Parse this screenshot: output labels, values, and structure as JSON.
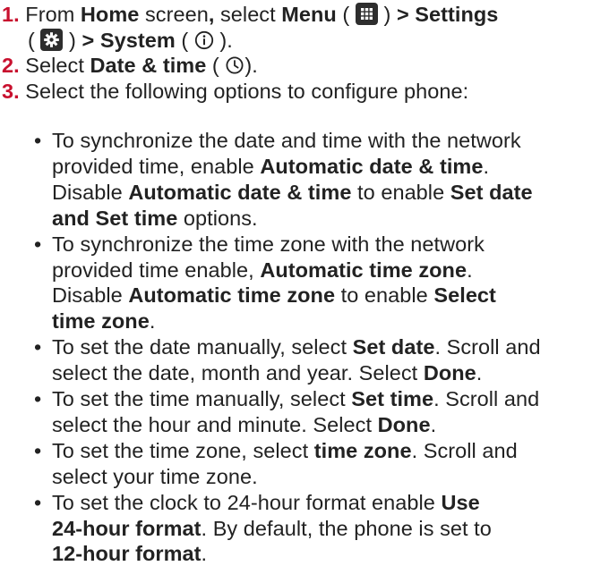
{
  "steps": [
    {
      "number": "1.",
      "line1": {
        "t1": "From ",
        "b1": "Home",
        "t2": " screen",
        "b2": ",",
        "t3": " select ",
        "b3": "Menu",
        "t4": " ( ",
        "t5": " ) ",
        "b4": "> Settings"
      },
      "line2": {
        "t1": "( ",
        "t2": " ) ",
        "b1": "> System",
        "t3": " ( ",
        "t4": " )."
      }
    },
    {
      "number": "2.",
      "t1": "Select ",
      "b1": "Date & time",
      "t2": " ( ",
      "t3": ")."
    },
    {
      "number": "3.",
      "t1": "Select the following options to configure phone:"
    }
  ],
  "bullets": [
    {
      "lines": [
        [
          {
            "t": "To synchronize the date and time with the network"
          }
        ],
        [
          {
            "t": "provided time, enable "
          },
          {
            "b": "Automatic date & time"
          },
          {
            "t": "."
          }
        ],
        [
          {
            "t": "Disable "
          },
          {
            "b": "Automatic date & time"
          },
          {
            "t": " to enable "
          },
          {
            "b": "Set date"
          }
        ],
        [
          {
            "b": "and "
          },
          {
            "b": "Set time"
          },
          {
            "t": " options."
          }
        ]
      ]
    },
    {
      "lines": [
        [
          {
            "t": "To synchronize the time zone with the network"
          }
        ],
        [
          {
            "t": "provided time enable, "
          },
          {
            "b": "Automatic time zone"
          },
          {
            "t": "."
          }
        ],
        [
          {
            "t": "Disable "
          },
          {
            "b": "Automatic time zone"
          },
          {
            "t": " to enable "
          },
          {
            "b": "Select"
          }
        ],
        [
          {
            "b": "time zone"
          },
          {
            "t": "."
          }
        ]
      ]
    },
    {
      "lines": [
        [
          {
            "t": "To set the date manually, select "
          },
          {
            "b": "Set date"
          },
          {
            "t": ". Scroll and"
          }
        ],
        [
          {
            "t": "select the date, month and year. Select "
          },
          {
            "b": "Done"
          },
          {
            "t": "."
          }
        ]
      ]
    },
    {
      "lines": [
        [
          {
            "t": "To set the time manually, select "
          },
          {
            "b": "Set time"
          },
          {
            "t": ". Scroll and"
          }
        ],
        [
          {
            "t": "select the hour and minute. Select "
          },
          {
            "b": "Done"
          },
          {
            "t": "."
          }
        ]
      ]
    },
    {
      "lines": [
        [
          {
            "t": "To set the time zone, select "
          },
          {
            "b": "time zone"
          },
          {
            "t": ". Scroll and"
          }
        ],
        [
          {
            "t": "select your time zone."
          }
        ]
      ]
    },
    {
      "lines": [
        [
          {
            "t": " To set the clock to 24-hour format enable "
          },
          {
            "b": "Use"
          }
        ],
        [
          {
            "b": "24-hour format"
          },
          {
            "t": ". By default, the phone is set to"
          }
        ],
        [
          {
            "b": "12-hour format"
          },
          {
            "t": "."
          }
        ]
      ]
    }
  ],
  "icons": {
    "menu": "grid-icon",
    "settings": "gear-icon",
    "system": "info-icon",
    "datetime": "clock-icon"
  },
  "colors": {
    "step_number": "#c8102e",
    "text": "#222222",
    "icon_box": "#2e2e2e"
  }
}
